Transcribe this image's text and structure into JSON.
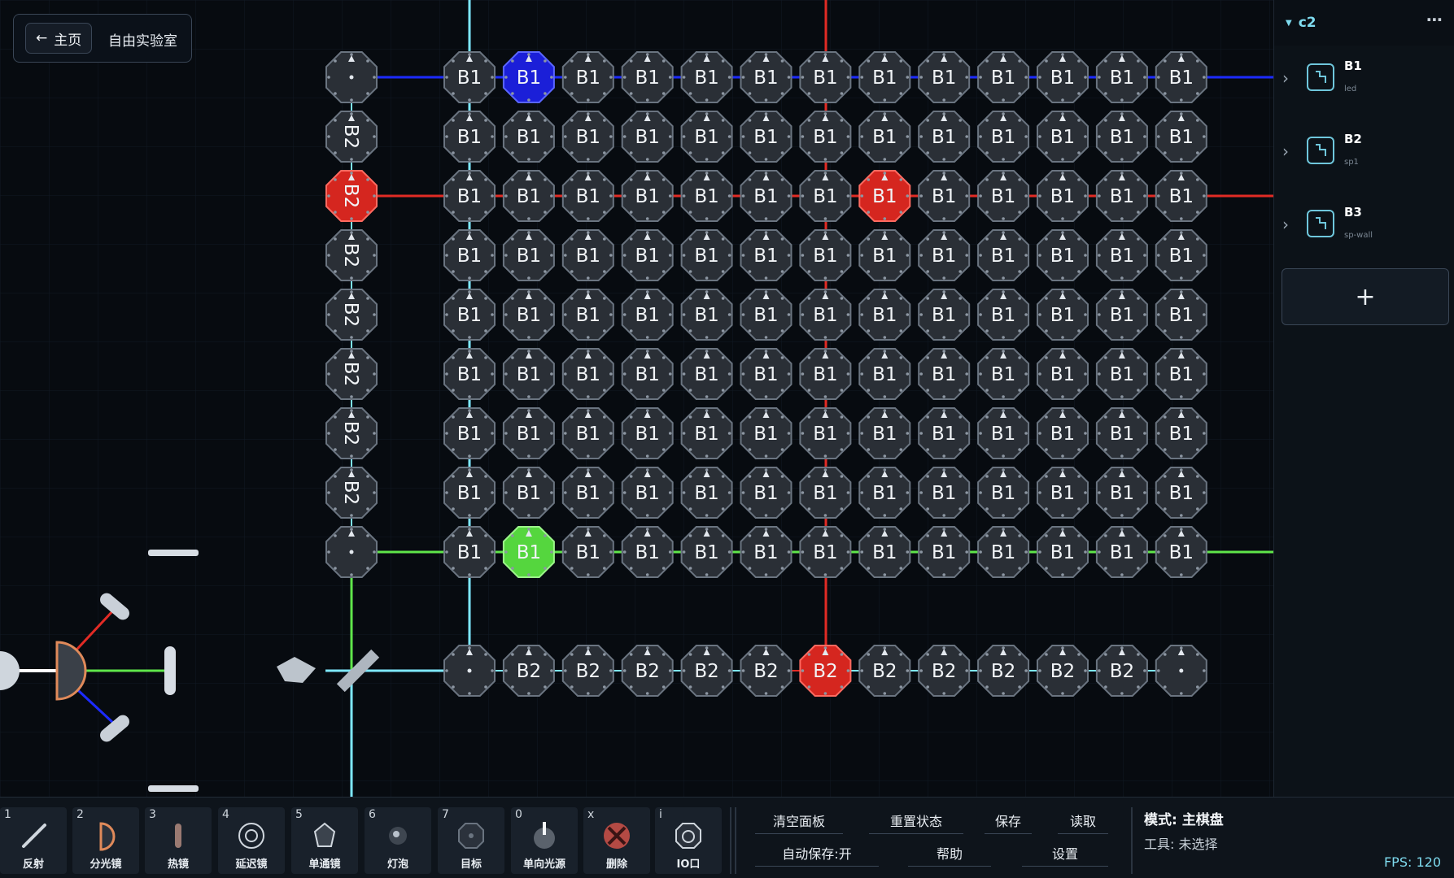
{
  "nav": {
    "home_label": "主页",
    "title": "自由实验室"
  },
  "board": {
    "component_label_b1": "B1",
    "component_label_b2": "B2",
    "beam_colors": {
      "blue": "#1c2bff",
      "red": "#e12b25",
      "green": "#5fe64a",
      "cyan": "#7ee8ff",
      "white": "#ffffff"
    },
    "highlights": {
      "blue_node": "B1",
      "red_node_top": "B2",
      "red_node_grid": "B1",
      "green_node": "B1",
      "red_node_bottom": "B2"
    }
  },
  "sidebar": {
    "group_name": "c2",
    "more_label": "⋯",
    "items": [
      {
        "name": "B1",
        "sub": "led"
      },
      {
        "name": "B2",
        "sub": "sp1"
      },
      {
        "name": "B3",
        "sub": "sp-wall"
      }
    ],
    "add_label": "+"
  },
  "toolbar": {
    "tools": [
      {
        "key": "1",
        "label": "反射",
        "icon": "mirror-icon"
      },
      {
        "key": "2",
        "label": "分光镜",
        "icon": "beam-splitter-icon"
      },
      {
        "key": "3",
        "label": "热镜",
        "icon": "hot-mirror-icon"
      },
      {
        "key": "4",
        "label": "延迟镜",
        "icon": "delay-lens-icon"
      },
      {
        "key": "5",
        "label": "单通镜",
        "icon": "one-way-lens-icon"
      },
      {
        "key": "6",
        "label": "灯泡",
        "icon": "bulb-icon"
      },
      {
        "key": "7",
        "label": "目标",
        "icon": "target-icon"
      },
      {
        "key": "0",
        "label": "单向光源",
        "icon": "light-source-icon"
      },
      {
        "key": "x",
        "label": "删除",
        "icon": "delete-icon"
      },
      {
        "key": "i",
        "label": "IO口",
        "icon": "io-port-icon"
      }
    ],
    "clear_label": "清空面板",
    "reset_label": "重置状态",
    "save_label": "保存",
    "load_label": "读取",
    "autosave_label": "自动保存:开",
    "help_label": "帮助",
    "settings_label": "设置",
    "mode_text": "模式: 主棋盘",
    "tool_text": "工具: 未选择",
    "fps_text": "FPS: 120"
  }
}
